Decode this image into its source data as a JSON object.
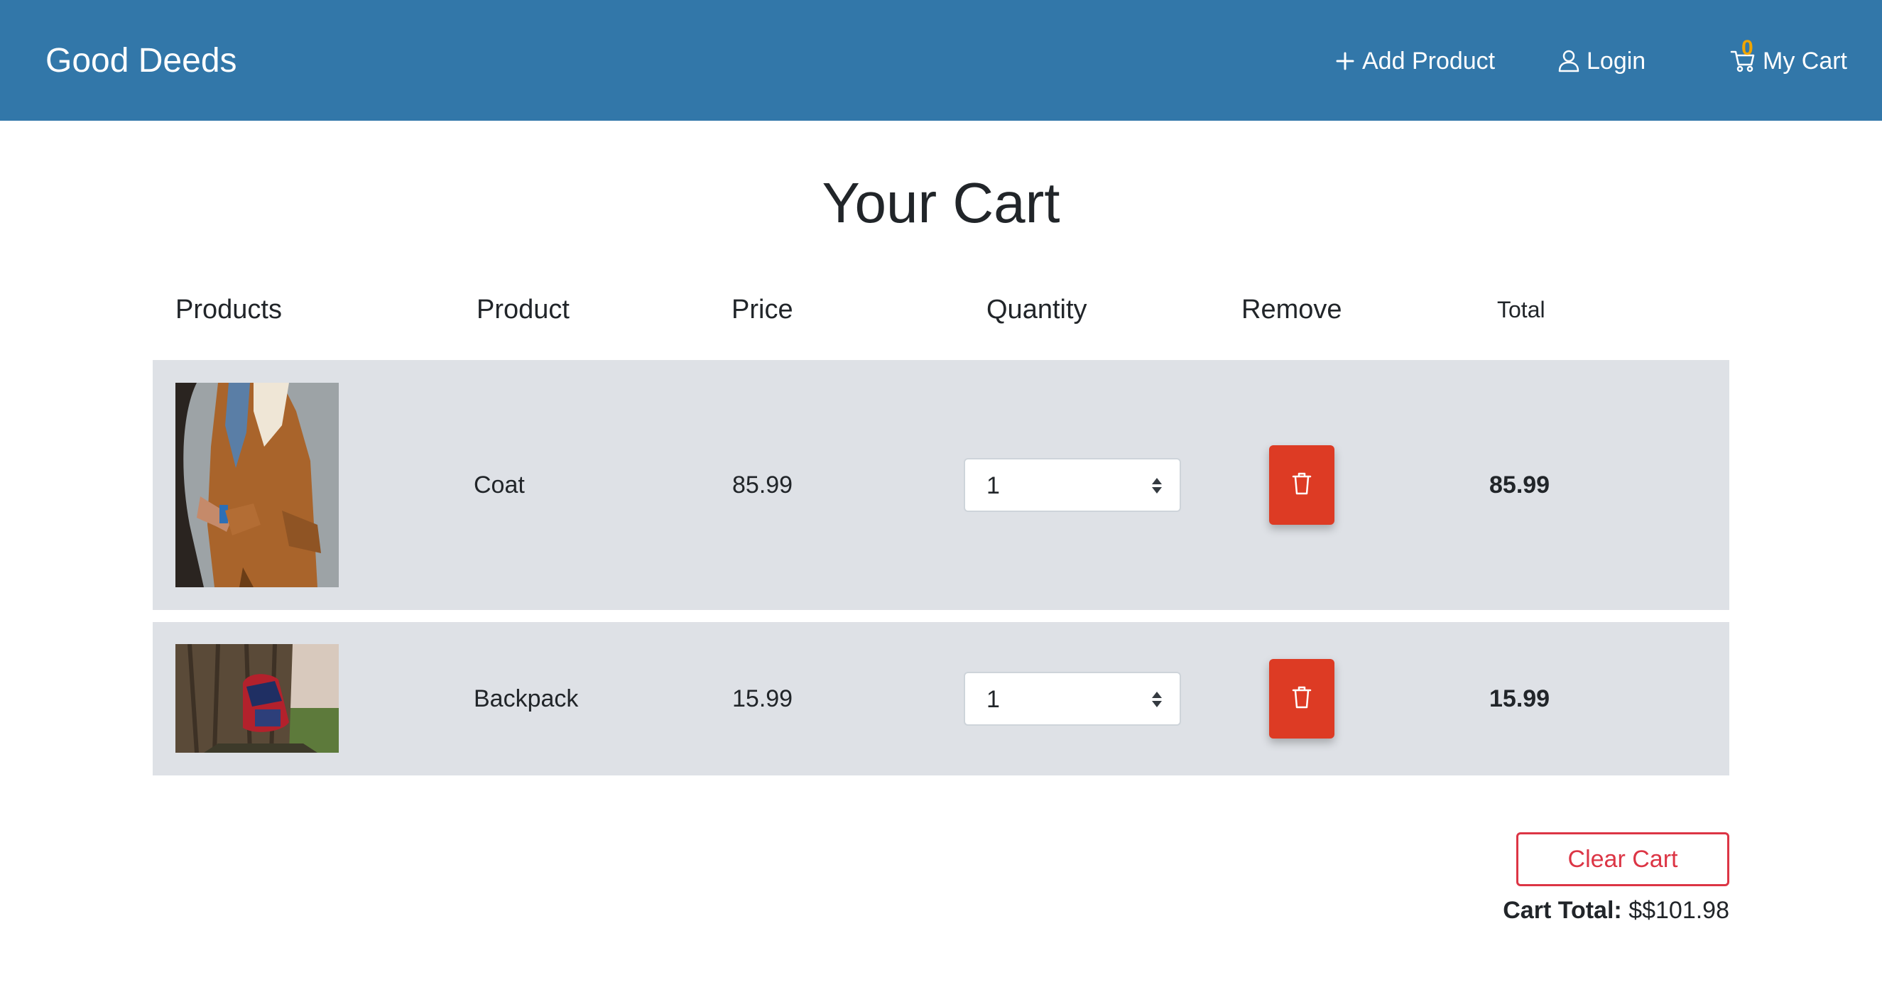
{
  "navbar": {
    "brand": "Good Deeds",
    "add_product": "Add Product",
    "login": "Login",
    "my_cart": "My Cart",
    "cart_count": "0",
    "background_color": "#3277a9"
  },
  "page": {
    "title": "Your Cart"
  },
  "table": {
    "headers": [
      "Products",
      "Product",
      "Price",
      "Quantity",
      "Remove",
      "Total"
    ],
    "rows": [
      {
        "image": "coat-photo",
        "name": "Coat",
        "price": "85.99",
        "quantity": "1",
        "total": "85.99"
      },
      {
        "image": "backpack-photo",
        "name": "Backpack",
        "price": "15.99",
        "quantity": "1",
        "total": "15.99"
      }
    ]
  },
  "actions": {
    "clear_cart": "Clear Cart",
    "cart_total_label": "Cart Total:",
    "cart_total_value": "$$101.98",
    "danger_color": "#dc3545"
  }
}
